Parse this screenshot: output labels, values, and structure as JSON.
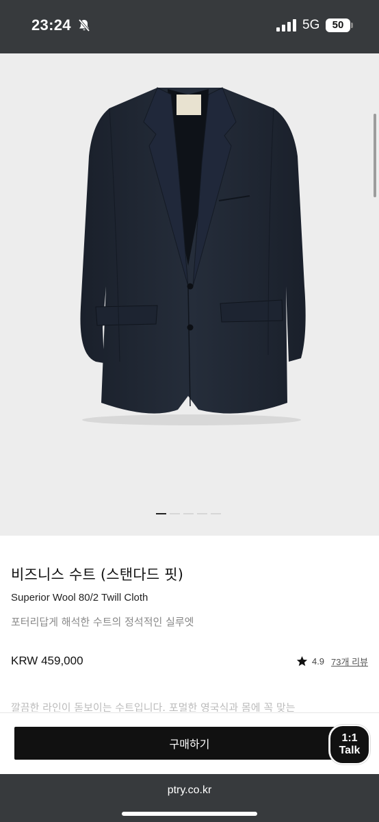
{
  "status_bar": {
    "time": "23:24",
    "network": "5G",
    "battery": "50",
    "icons": [
      "bell-off-icon",
      "signal-icon"
    ]
  },
  "product": {
    "title": "비즈니스 수트 (스탠다드 핏)",
    "subtitle": "Superior Wool 80/2 Twill Cloth",
    "description": "포터리답게 해석한 수트의 정석적인 실루엣",
    "price": "KRW 459,000",
    "rating": "4.9",
    "reviews": "73개 리뷰",
    "teaser": "깔끔한 라인이 돋보이는 수트입니다. 포멀한 영국식과 몸에 꼭 맞는",
    "image_dots": 5,
    "active_dot": 0
  },
  "actions": {
    "buy_label": "구매하기",
    "talk_line1": "1:1",
    "talk_line2": "Talk"
  },
  "browser": {
    "url": "ptry.co.kr"
  },
  "colors": {
    "status_bg": "#373a3d",
    "hero_bg": "#ededed",
    "jacket": "#1f2632",
    "button": "#111111"
  }
}
